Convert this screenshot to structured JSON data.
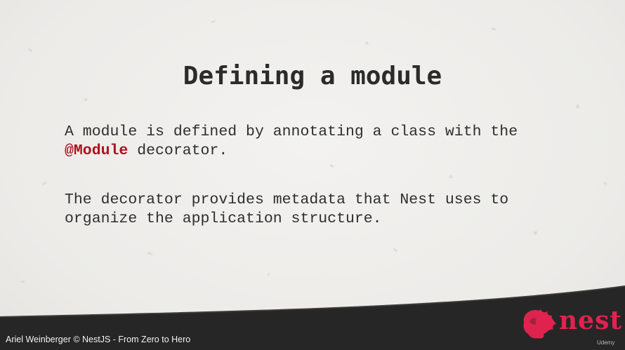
{
  "slide": {
    "title": "Defining a module",
    "paragraph1_part1": "A module is defined by annotating a class with the",
    "paragraph1_keyword": "@Module",
    "paragraph1_part2": " decorator.",
    "paragraph2_line1": "The decorator provides metadata that Nest uses to",
    "paragraph2_line2": "organize the application structure."
  },
  "footer": {
    "author": "Ariel Weinberger © NestJS - From Zero to Hero",
    "logo_text": "nest",
    "watermark": "Udemy"
  },
  "colors": {
    "background": "#efeeec",
    "footer": "#262626",
    "keyword": "#b0101f",
    "nest_red": "#e0234e"
  }
}
